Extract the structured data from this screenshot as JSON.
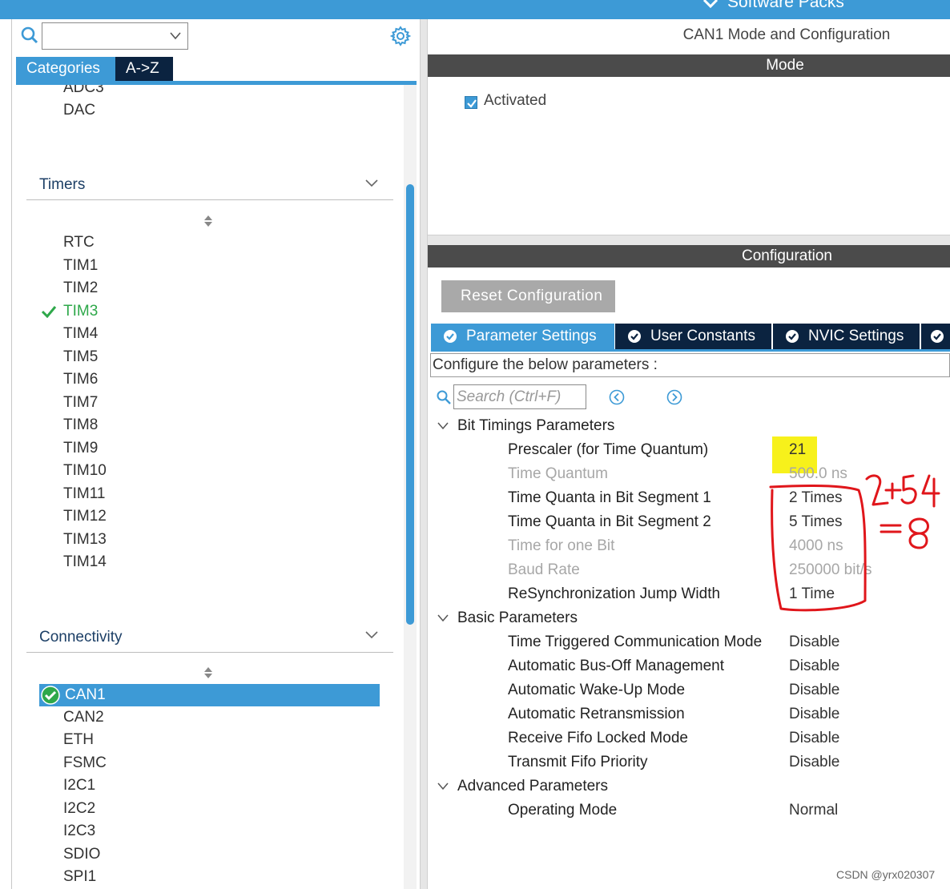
{
  "header": {
    "software_packs_label": "Software Packs"
  },
  "left": {
    "tabs": [
      "Categories",
      "A->Z"
    ],
    "analog_items": [
      "ADC3",
      "DAC"
    ],
    "timers": {
      "title": "Timers",
      "items": [
        "RTC",
        "TIM1",
        "TIM2",
        "TIM3",
        "TIM4",
        "TIM5",
        "TIM6",
        "TIM7",
        "TIM8",
        "TIM9",
        "TIM10",
        "TIM11",
        "TIM12",
        "TIM13",
        "TIM14"
      ],
      "checked": "TIM3"
    },
    "connectivity": {
      "title": "Connectivity",
      "items": [
        "CAN1",
        "CAN2",
        "ETH",
        "FSMC",
        "I2C1",
        "I2C2",
        "I2C3",
        "SDIO",
        "SPI1"
      ],
      "selected": "CAN1"
    }
  },
  "right": {
    "title": "CAN1 Mode and Configuration",
    "mode_header": "Mode",
    "activated_label": "Activated",
    "config_header": "Configuration",
    "reset_label": "Reset Configuration",
    "tabs": [
      "Parameter Settings",
      "User Constants",
      "NVIC Settings"
    ],
    "hint": "Configure the below parameters :",
    "search_placeholder": "Search (Ctrl+F)",
    "sections": [
      {
        "title": "Bit Timings Parameters",
        "params": [
          {
            "name": "Prescaler (for Time Quantum)",
            "value": "21"
          },
          {
            "name": "Time Quantum",
            "value": "500.0 ns"
          },
          {
            "name": "Time Quanta in Bit Segment 1",
            "value": "2 Times"
          },
          {
            "name": "Time Quanta in Bit Segment 2",
            "value": "5 Times"
          },
          {
            "name": "Time for one Bit",
            "value": "4000 ns"
          },
          {
            "name": "Baud Rate",
            "value": "250000 bit/s"
          },
          {
            "name": "ReSynchronization Jump Width",
            "value": "1 Time"
          }
        ]
      },
      {
        "title": "Basic Parameters",
        "params": [
          {
            "name": "Time Triggered Communication Mode",
            "value": "Disable"
          },
          {
            "name": "Automatic Bus-Off Management",
            "value": "Disable"
          },
          {
            "name": "Automatic Wake-Up Mode",
            "value": "Disable"
          },
          {
            "name": "Automatic Retransmission",
            "value": "Disable"
          },
          {
            "name": "Receive Fifo Locked Mode",
            "value": "Disable"
          },
          {
            "name": "Transmit Fifo Priority",
            "value": "Disable"
          }
        ]
      },
      {
        "title": "Advanced Parameters",
        "params": [
          {
            "name": "Operating Mode",
            "value": "Normal"
          }
        ]
      }
    ]
  },
  "watermark": "CSDN @yrx020307",
  "colors": {
    "accent": "#3d9ad6",
    "dark_tab": "#0b2340",
    "header_bar": "#4b4b4b",
    "check_green": "#2ea84a",
    "annotation_red": "#e0161b",
    "highlight_yellow": "#f7f11b"
  }
}
